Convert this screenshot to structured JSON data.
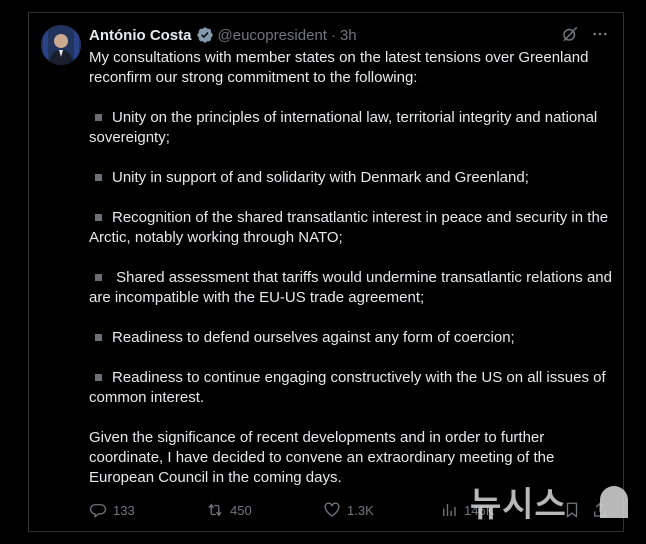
{
  "post": {
    "author_name": "António Costa",
    "handle": "@eucopresident",
    "separator": "·",
    "time": "3h",
    "paragraphs": [
      {
        "bullet": false,
        "text": "My consultations with member states on the latest tensions over Greenland reconfirm our strong commitment to the following:"
      },
      {
        "bullet": true,
        "text": "Unity on the principles of international law, territorial integrity and national sovereignty;"
      },
      {
        "bullet": true,
        "text": "Unity in support of and solidarity with Denmark and Greenland;"
      },
      {
        "bullet": true,
        "text": "Recognition of the shared transatlantic interest in peace and security in the Arctic, notably working through NATO;"
      },
      {
        "bullet": true,
        "text": " Shared assessment that tariffs would undermine transatlantic relations and are incompatible with the EU-US trade agreement;"
      },
      {
        "bullet": true,
        "text": "Readiness to defend ourselves against any form of coercion;"
      },
      {
        "bullet": true,
        "text": "Readiness to continue engaging constructively with the US on all issues of common interest."
      },
      {
        "bullet": false,
        "text": "Given the significance of recent developments and in order to further coordinate, I have decided to convene an extraordinary meeting of the European Council in the coming days."
      }
    ],
    "stats": {
      "replies": "133",
      "reposts": "450",
      "likes": "1.3K",
      "views": "146K"
    }
  },
  "icons": {
    "verified": "verified-badge-icon",
    "grok": "grok-icon",
    "more": "more-icon",
    "reply": "reply-icon",
    "repost": "repost-icon",
    "like": "like-icon",
    "views": "views-icon",
    "bookmark": "bookmark-icon",
    "share": "share-icon"
  },
  "colors": {
    "background": "#000000",
    "text": "#e7e9ea",
    "muted": "#71767b",
    "verified": "#829aab",
    "border": "#2f3336"
  },
  "watermark": {
    "text": "뉴시스"
  }
}
